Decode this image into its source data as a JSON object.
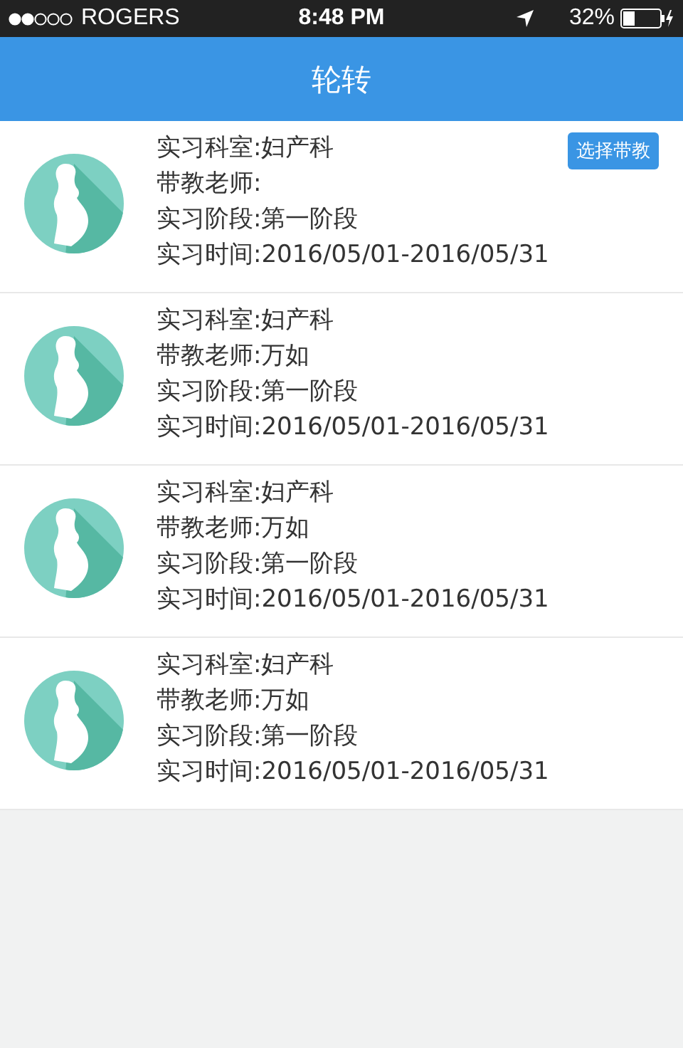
{
  "status_bar": {
    "carrier": "ROGERS",
    "time": "8:48 PM",
    "battery": "32%"
  },
  "nav": {
    "title": "轮转"
  },
  "items": [
    {
      "lines": [
        "实习科室:妇产科",
        "带教老师:",
        "实习阶段:第一阶段",
        "实习时间:2016/05/01-2016/05/31"
      ],
      "button": "选择带教"
    },
    {
      "lines": [
        "实习科室:妇产科",
        "带教老师:万如",
        "实习阶段:第一阶段",
        "实习时间:2016/05/01-2016/05/31"
      ]
    },
    {
      "lines": [
        "实习科室:妇产科",
        "带教老师:万如",
        "实习阶段:第一阶段",
        "实习时间:2016/05/01-2016/05/31"
      ]
    },
    {
      "lines": [
        "实习科室:妇产科",
        "带教老师:万如",
        "实习阶段:第一阶段",
        "实习时间:2016/05/01-2016/05/31"
      ]
    }
  ]
}
